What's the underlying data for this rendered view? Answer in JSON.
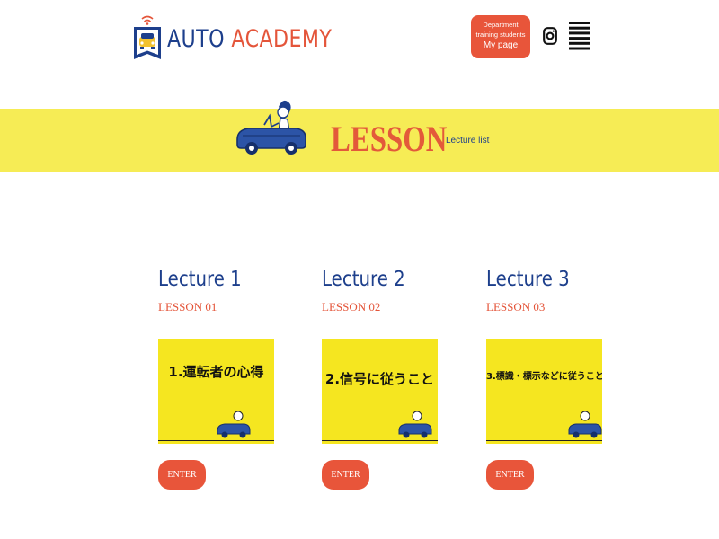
{
  "header": {
    "logo_word1": "AUTO",
    "logo_word2": "ACADEMY",
    "mypage_line1": "Department",
    "mypage_line2": "training students",
    "mypage_line3": "My page",
    "instagram_icon": "instagram-icon",
    "menu_icon": "menu-icon"
  },
  "banner": {
    "title": "LESSON",
    "subtitle": "Lecture list"
  },
  "lectures": [
    {
      "title": "Lecture 1",
      "subtitle": "LESSON 01",
      "thumb_text": "1.運転者の心得",
      "enter": "ENTER"
    },
    {
      "title": "Lecture 2",
      "subtitle": "LESSON 02",
      "thumb_text": "2.信号に従うこと",
      "enter": "ENTER"
    },
    {
      "title": "Lecture 3",
      "subtitle": "LESSON 03",
      "thumb_text": "3.標識・標示などに従うこと",
      "enter": "ENTER"
    }
  ],
  "colors": {
    "brand_blue": "#1d3f8c",
    "brand_orange": "#e4553a",
    "banner_yellow": "#f6ec55",
    "thumb_yellow": "#f5e620"
  }
}
